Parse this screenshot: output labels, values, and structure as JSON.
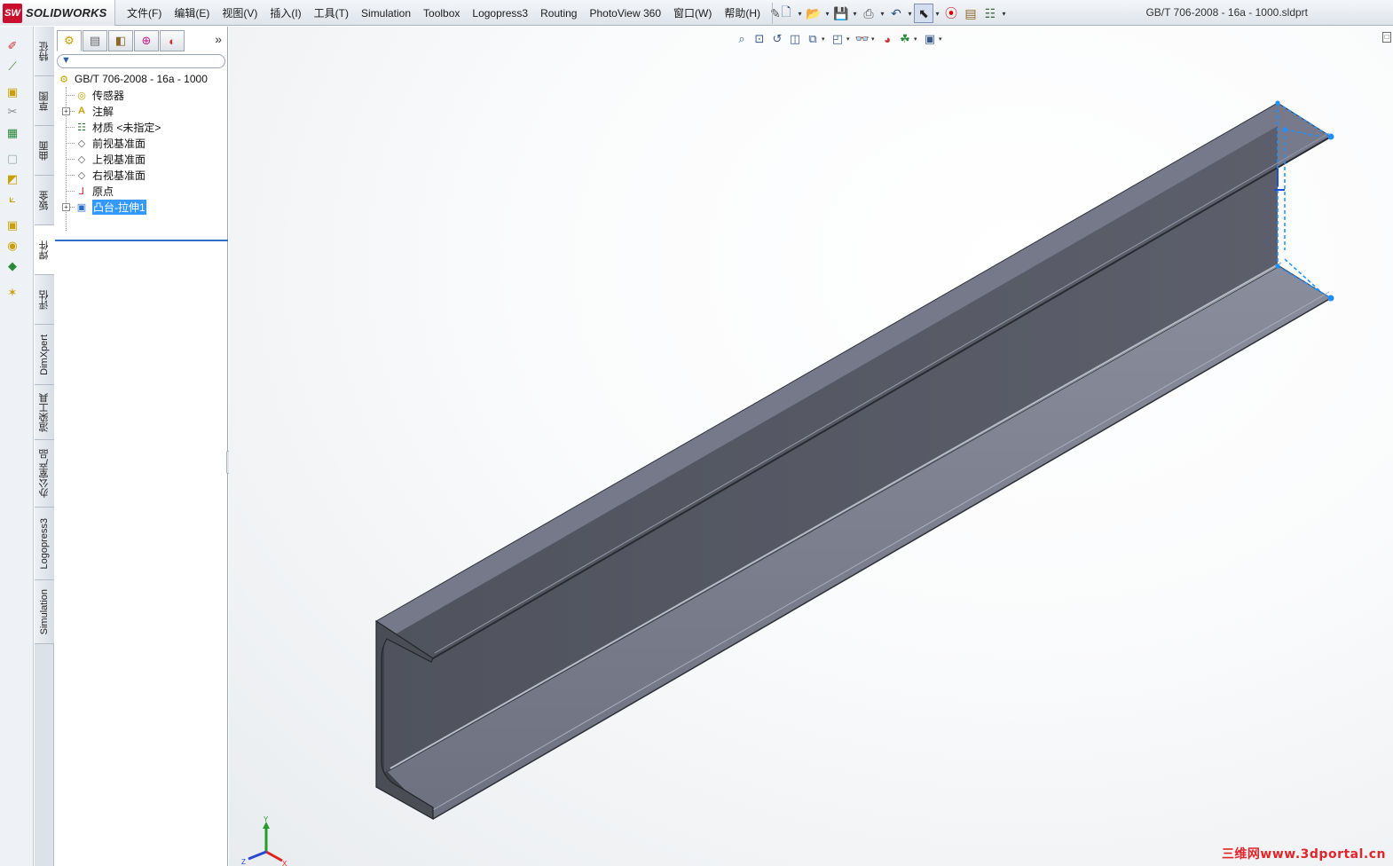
{
  "app": {
    "brand": "SOLIDWORKS",
    "logo_badge": "SW",
    "document_title": "GB/T 706-2008 - 16a - 1000.sldprt"
  },
  "menu": {
    "items": [
      "文件(F)",
      "编辑(E)",
      "视图(V)",
      "插入(I)",
      "工具(T)",
      "Simulation",
      "Toolbox",
      "Logopress3",
      "Routing",
      "PhotoView 360",
      "窗口(W)",
      "帮助(H)"
    ],
    "pin_icon": "pushpin-icon"
  },
  "standard_toolbar": [
    "new-document-icon",
    "open-icon",
    "save-icon",
    "print-icon",
    "undo-icon",
    "select-arrow-icon",
    "rebuild-traffic-light-icon",
    "file-properties-icon",
    "options-icon"
  ],
  "left_tabs": [
    "特征",
    "草图",
    "曲面",
    "钣金",
    "焊件",
    "评估",
    "DimXpert",
    "渲染工具",
    "办公室产品",
    "Logopress3",
    "Simulation"
  ],
  "left_tabs_active": "焊件",
  "feature_manager": {
    "tabs": [
      "feature-tree-icon",
      "property-manager-icon",
      "configuration-manager-icon",
      "dimxpert-manager-icon",
      "display-manager-icon"
    ],
    "more": "»",
    "root": "GB/T 706-2008 - 16a - 1000",
    "items": [
      {
        "label": "传感器",
        "icon": "sensor-icon",
        "expandable": false
      },
      {
        "label": "注解",
        "icon": "annotations-icon",
        "expandable": true
      },
      {
        "label": "材质 <未指定>",
        "icon": "material-icon",
        "expandable": false
      },
      {
        "label": "前视基准面",
        "icon": "plane-icon",
        "expandable": false
      },
      {
        "label": "上视基准面",
        "icon": "plane-icon",
        "expandable": false
      },
      {
        "label": "右视基准面",
        "icon": "plane-icon",
        "expandable": false
      },
      {
        "label": "原点",
        "icon": "origin-icon",
        "expandable": false
      },
      {
        "label": "凸台-拉伸1",
        "icon": "boss-extrude-icon",
        "expandable": true,
        "selected": true
      }
    ]
  },
  "heads_up_toolbar": [
    "zoom-to-fit-icon",
    "zoom-to-area-icon",
    "previous-view-icon",
    "section-view-icon",
    "view-orientation-icon",
    "display-style-icon",
    "hide-show-items-icon",
    "edit-appearance-icon",
    "apply-scene-icon",
    "view-settings-icon"
  ],
  "triad": {
    "x": "X",
    "y": "Y",
    "z": "Z"
  },
  "watermark": "三维网www.3dportal.cn",
  "colors": {
    "steel_top": "#7a7d8c",
    "steel_web": "#5a5c68",
    "steel_dark": "#3d3f48",
    "selection_blue": "#3399ff",
    "sketch_blue": "#1f8fff"
  }
}
